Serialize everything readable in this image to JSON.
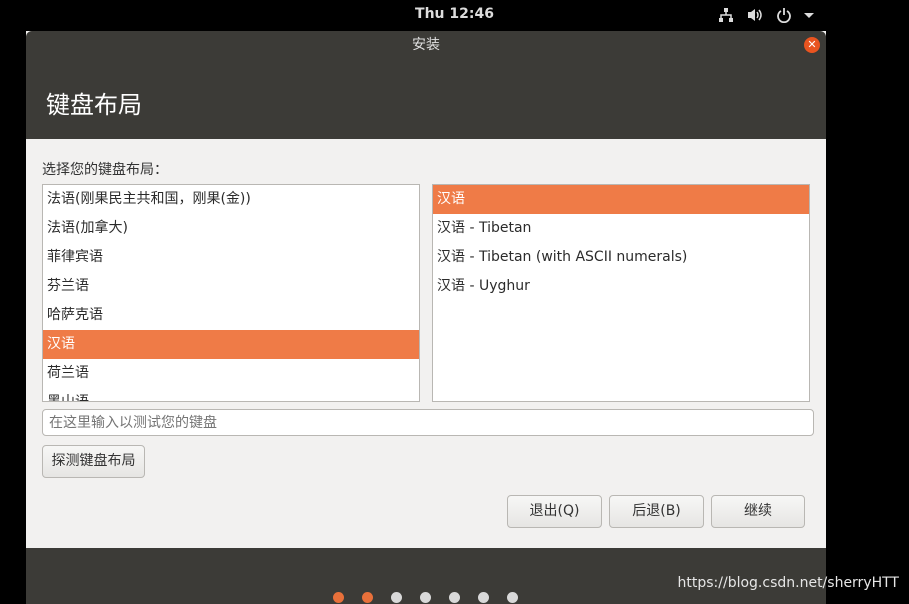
{
  "topbar": {
    "clock": "Thu 12:46",
    "icons": [
      "network-icon",
      "volume-icon",
      "power-icon",
      "chevron-down-icon"
    ]
  },
  "window": {
    "title": "安装",
    "header": "键盘布局",
    "accent": "#ef7b47"
  },
  "main": {
    "prompt": "选择您的键盘布局：",
    "languages": [
      "法语(刚果民主共和国，刚果(金))",
      "法语(加拿大)",
      "菲律宾语",
      "芬兰语",
      "哈萨克语",
      "汉语",
      "荷兰语",
      "黑山语"
    ],
    "selected_language": "汉语",
    "variants": [
      "汉语",
      "汉语 - Tibetan",
      "汉语 - Tibetan (with ASCII numerals)",
      "汉语 - Uyghur"
    ],
    "selected_variant": "汉语",
    "test_placeholder": "在这里输入以测试您的键盘",
    "detect_button": "探测键盘布局"
  },
  "buttons": {
    "quit": "退出(Q)",
    "back": "后退(B)",
    "continue": "继续"
  },
  "progress": {
    "total_steps": 7,
    "completed_steps": 2
  },
  "watermark": "https://blog.csdn.net/sherryHTT"
}
